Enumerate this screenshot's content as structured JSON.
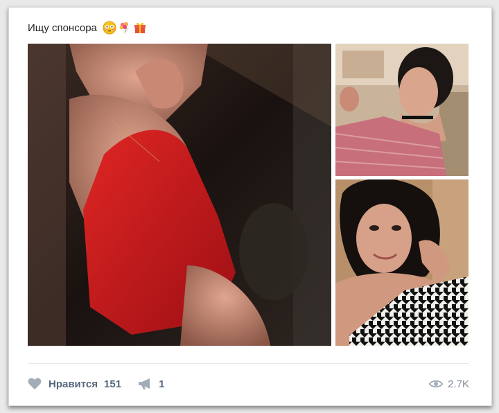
{
  "post": {
    "text": "Ищу спонсора",
    "emojis": [
      "flushed-face",
      "bouquet",
      "gift"
    ]
  },
  "photos": [
    {
      "name": "photo-main",
      "alt": "woman in red dress"
    },
    {
      "name": "photo-top",
      "alt": "selfie with choker"
    },
    {
      "name": "photo-bottom",
      "alt": "selfie in houndstooth top"
    }
  ],
  "footer": {
    "like_label": "Нравится",
    "like_count": "151",
    "share_count": "1",
    "views": "2.7K"
  },
  "colors": {
    "action_text": "#55677d",
    "icon": "#a3adb8",
    "views_text": "#828a99",
    "divider": "#e7e8ec"
  }
}
